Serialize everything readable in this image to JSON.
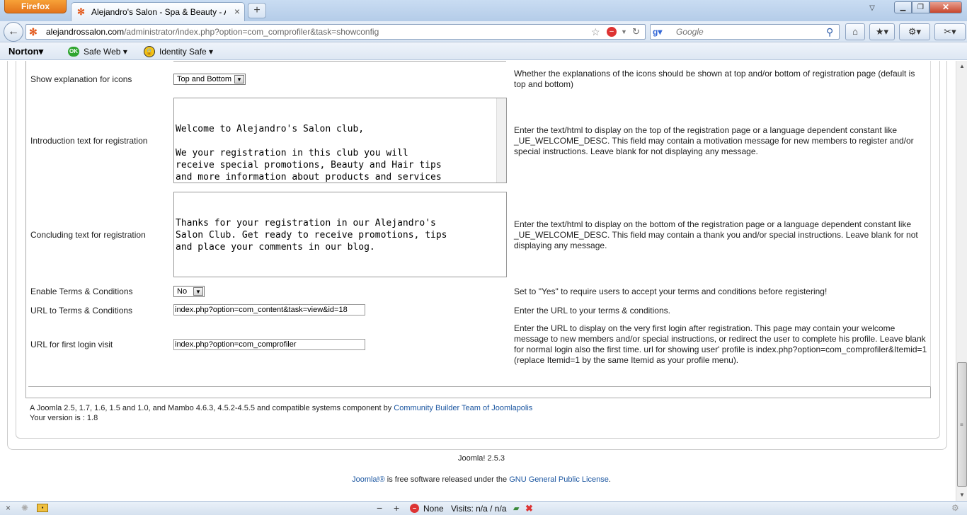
{
  "browser": {
    "app_button": "Firefox",
    "tab_title": "Alejandro's Salon - Spa & Beauty - Admi...",
    "url_domain": "alejandrossalon.com",
    "url_path": "/administrator/index.php?option=com_comprofiler&task=showconfig",
    "search_placeholder": "Google",
    "accent_color": "#e3731b"
  },
  "norton": {
    "brand": "Norton",
    "safe_web_icon": "OK",
    "safe_web": "Safe Web",
    "identity_safe": "Identity Safe"
  },
  "settings": [
    {
      "label": "Show explanation for icons",
      "type": "select",
      "value": "Top and Bottom",
      "description": "Whether the explanations of the icons should be shown at top and/or bottom of registration page (default is top and bottom)"
    },
    {
      "label": "Introduction text for registration",
      "type": "textarea",
      "value": "Welcome to Alejandro's Salon club,\n\nWe your registration in this club you will\nreceive special promotions, Beauty and Hair tips\nand more information about products and services\navailable for you.",
      "description": "Enter the text/html to display on the top of the registration page or a language dependent constant like _UE_WELCOME_DESC. This field may contain a motivation message for new members to register and/or special instructions. Leave blank for not displaying any message."
    },
    {
      "label": "Concluding text for registration",
      "type": "textarea",
      "value": "Thanks for your registration in our Alejandro's\nSalon Club. Get ready to receive promotions, tips\nand place your comments in our blog.",
      "description": "Enter the text/html to display on the bottom of the registration page or a language dependent constant like _UE_WELCOME_DESC. This field may contain a thank you and/or special instructions. Leave blank for not displaying any message."
    },
    {
      "label": "Enable Terms & Conditions",
      "type": "select",
      "value": "No",
      "description": "Set to \"Yes\" to require users to accept your terms and conditions before registering!"
    },
    {
      "label": "URL to Terms & Conditions",
      "type": "text",
      "value": "index.php?option=com_content&task=view&id=18",
      "description": "Enter the URL to your terms & conditions."
    },
    {
      "label": "URL for first login visit",
      "type": "text",
      "value": "index.php?option=com_comprofiler",
      "description": "Enter the URL to display on the very first login after registration. This page may contain your welcome message to new members and/or special instructions, or redirect the user to complete his profile. Leave blank for normal login also the first time. url for showing user' profile is index.php?option=com_comprofiler&Itemid=1 (replace Itemid=1 by the same Itemid as your profile menu)."
    }
  ],
  "footer": {
    "compat_prefix": "A Joomla 2.5, 1.7, 1.6, 1.5 and 1.0, and Mambo 4.6.3, 4.5.2-4.5.5 and compatible systems component by",
    "team_link": "Community Builder Team of Joomlapolis",
    "version": "Your version is : 1.8",
    "joomla_version": "Joomla! 2.5.3",
    "joomla_link": "Joomla!®",
    "license_mid": "is free software released under the",
    "license_link": "GNU General Public License",
    "license_end": "."
  },
  "statusbar": {
    "zoom_out": "−",
    "zoom_in": "+",
    "none_label": "None",
    "visits": "Visits: n/a / n/a"
  }
}
